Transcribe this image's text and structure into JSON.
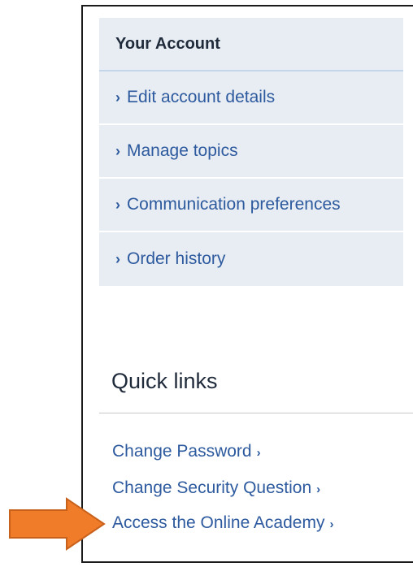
{
  "account": {
    "title": "Your Account",
    "items": [
      {
        "label": "Edit account details"
      },
      {
        "label": "Manage topics"
      },
      {
        "label": "Communication preferences"
      },
      {
        "label": "Order history"
      }
    ]
  },
  "quick_links": {
    "title": "Quick links",
    "items": [
      {
        "label": "Change Password"
      },
      {
        "label": "Change Security Question"
      },
      {
        "label": "Access the Online Academy"
      }
    ]
  },
  "icons": {
    "item_chevron": "›",
    "link_chevron": "›",
    "pointer_arrow": "arrow-right-icon"
  },
  "colors": {
    "link": "#2d5a9e",
    "panel_bg": "#e8edf3",
    "arrow": "#f07c2a"
  }
}
